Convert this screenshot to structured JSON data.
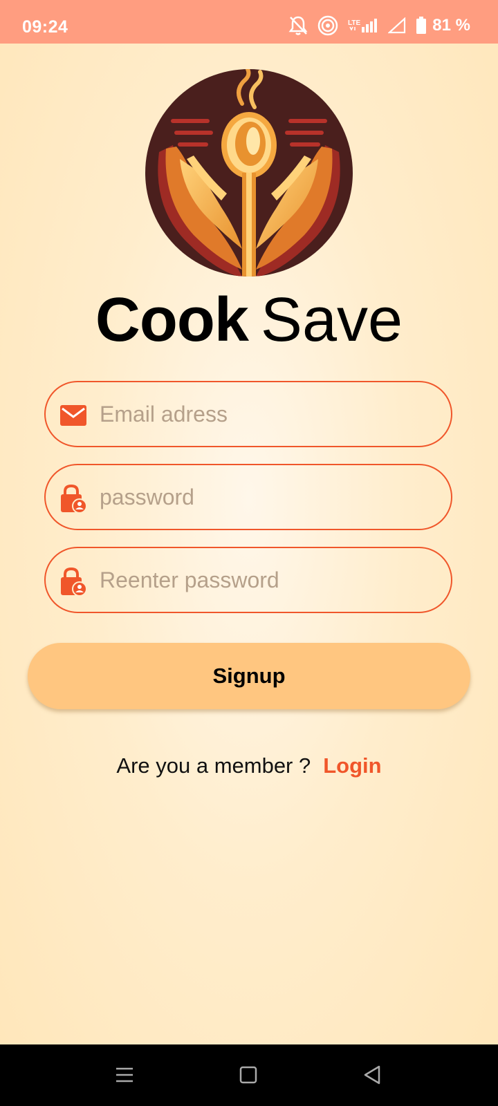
{
  "status_bar": {
    "time": "09:24",
    "battery": "81 %",
    "icons": [
      "notifications-off-icon",
      "hotspot-icon",
      "lte-icon",
      "signal-icon",
      "signal-empty-icon",
      "battery-icon"
    ],
    "network_label": "LTE"
  },
  "app": {
    "logo_icon": "cook-save-logo",
    "title_bold": "Cook",
    "title_light": "Save"
  },
  "form": {
    "email_placeholder": "Email adress",
    "email_value": "",
    "email_icon": "mail-icon",
    "password_placeholder": "password",
    "password_value": "",
    "password_icon": "lock-user-icon",
    "reenter_placeholder": "Reenter password",
    "reenter_value": "",
    "reenter_icon": "lock-user-icon",
    "signup_label": "Signup"
  },
  "footer": {
    "member_text": "Are you a member ?",
    "login_label": "Login"
  },
  "nav": {
    "icons": [
      "menu-icon",
      "home-icon",
      "back-icon"
    ]
  },
  "colors": {
    "status_bar": "#ff9d80",
    "accent": "#f0562a",
    "button": "#ffc680",
    "background": "#ffe6b9"
  }
}
